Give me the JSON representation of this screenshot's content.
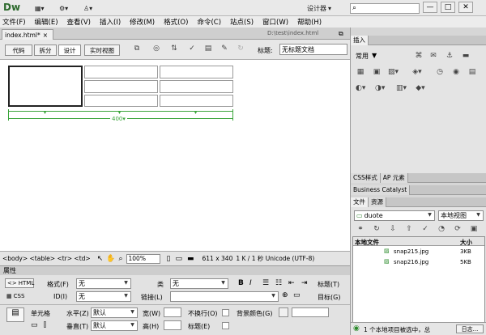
{
  "app": {
    "logo": "Dw",
    "workspace": "设计器",
    "window_controls": {
      "minimize": "—",
      "restore": "□",
      "close": "✕"
    }
  },
  "menu": [
    "文件(F)",
    "编辑(E)",
    "查看(V)",
    "插入(I)",
    "修改(M)",
    "格式(O)",
    "命令(C)",
    "站点(S)",
    "窗口(W)",
    "帮助(H)"
  ],
  "document": {
    "tab": "index.html*",
    "close": "×",
    "path": "D:\\test\\index.html",
    "views": [
      "代码",
      "拆分",
      "设计",
      "实时视图"
    ],
    "active_view": "设计",
    "title_label": "标题:",
    "title_value": "无标题文档"
  },
  "canvas": {
    "table_width_label": "400"
  },
  "status": {
    "tags": "<body> <table> <tr> <td>",
    "zoom": "100%",
    "size": "611 x 340",
    "info": "1 K / 1 秒  Unicode (UTF-8)"
  },
  "properties": {
    "panel_title": "属性",
    "html_btn": "HTML",
    "css_btn": "CSS",
    "format_label": "格式(F)",
    "format_value": "无",
    "class_label": "类",
    "class_value": "无",
    "id_label": "ID(I)",
    "id_value": "无",
    "link_label": "链接(L)",
    "title_label": "标题(T)",
    "target_label": "目标(G)",
    "cell_label": "单元格",
    "horz_label": "水平(Z)",
    "horz_value": "默认",
    "vert_label": "垂直(T)",
    "vert_value": "默认",
    "width_label": "宽(W)",
    "height_label": "高(H)",
    "nowrap_label": "不换行(O)",
    "bg_label": "背景颜色(G)",
    "header_label": "标题(E)"
  },
  "insert_panel": {
    "tab": "插入",
    "category": "常用"
  },
  "css_panel": {
    "tabs": [
      "CSS样式",
      "AP 元素"
    ]
  },
  "bc_panel": {
    "tab": "Business Catalyst"
  },
  "files_panel": {
    "tabs": [
      "文件",
      "资源"
    ],
    "site": "duote",
    "view": "本地视图",
    "col_name": "本地文件",
    "col_size": "大小",
    "files": [
      {
        "name": "snap215.jpg",
        "size": "3KB"
      },
      {
        "name": "snap216.jpg",
        "size": "5KB"
      }
    ],
    "status": "1 个本地项目被选中，总",
    "log_btn": "日志..."
  }
}
